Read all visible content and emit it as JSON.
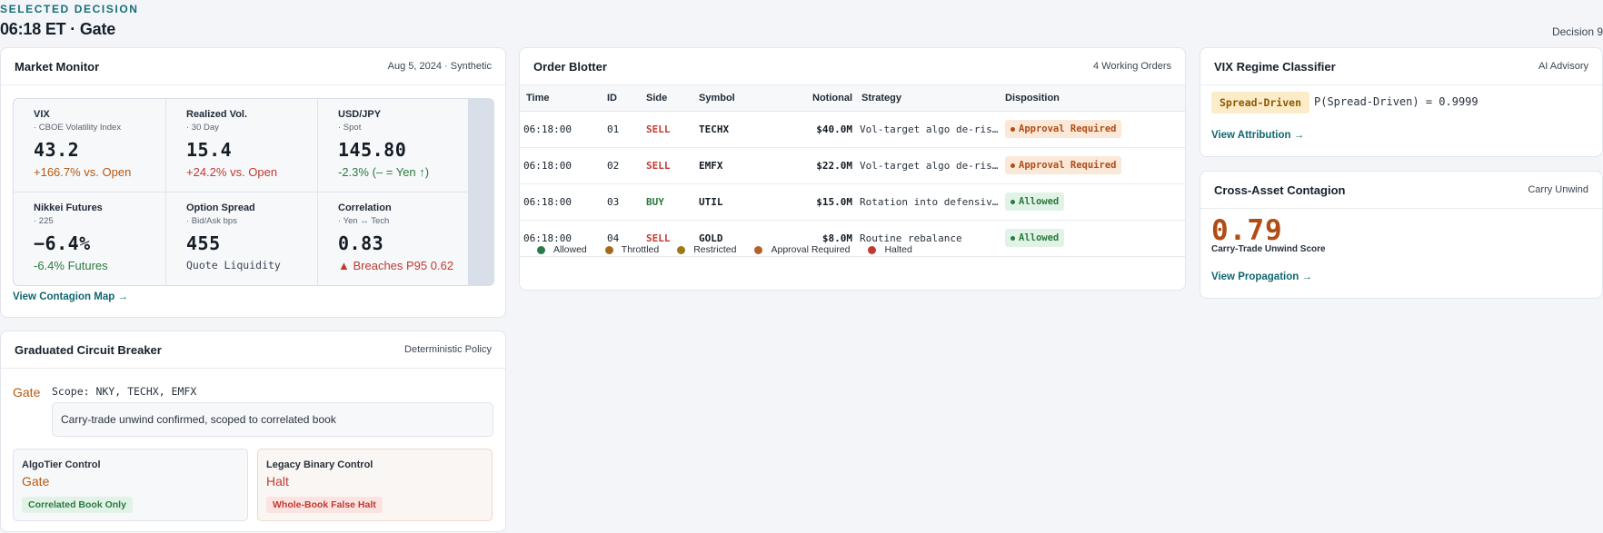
{
  "header": {
    "eyebrow": "SELECTED DECISION",
    "title": "06:18 ET · Gate",
    "decision_label": "Decision 9"
  },
  "market_monitor": {
    "title": "Market Monitor",
    "meta": "Aug 5, 2024 · Synthetic",
    "tiles": [
      {
        "label": "VIX",
        "sub": "· CBOE Volatility Index",
        "value": "43.2",
        "note": "+166.7% vs. Open",
        "tone": "orange"
      },
      {
        "label": "Realized Vol.",
        "sub": "· 30 Day",
        "value": "15.4",
        "note": "+24.2% vs. Open",
        "tone": "red"
      },
      {
        "label": "USD/JPY",
        "sub": "· Spot",
        "value": "145.80",
        "note": "-2.3% (– = Yen ↑)",
        "tone": "green"
      },
      {
        "label": "Nikkei Futures",
        "sub": "· 225",
        "value": "−6.4%",
        "note": "-6.4% Futures",
        "tone": "green"
      },
      {
        "label": "Option Spread",
        "sub": "· Bid/Ask bps",
        "value": "455",
        "note": "Quote Liquidity",
        "tone": "gray"
      },
      {
        "label": "Correlation",
        "sub": "· Yen ↔ Tech",
        "value": "0.83",
        "note": "▲ Breaches P95 0.62",
        "tone": "red"
      }
    ],
    "link": "View Contagion Map →"
  },
  "circuit_breaker": {
    "title": "Graduated Circuit Breaker",
    "meta": "Deterministic Policy",
    "state": "Gate",
    "scope": "Scope: NKY, TECHX, EMFX",
    "message": "Carry-trade unwind confirmed, scoped to correlated book",
    "algotier": {
      "title": "AlgoTier Control",
      "value": "Gate",
      "pill": "Correlated Book Only"
    },
    "legacy": {
      "title": "Legacy Binary Control",
      "value": "Halt",
      "pill": "Whole-Book False Halt"
    }
  },
  "order_blotter": {
    "title": "Order Blotter",
    "meta": "4 Working Orders",
    "columns": [
      "Time",
      "ID",
      "Side",
      "Symbol",
      "Notional",
      "Strategy",
      "Disposition"
    ],
    "rows": [
      {
        "time": "06:18:00",
        "id": "01",
        "side": "SELL",
        "symbol": "TECHX",
        "notional": "$40.0M",
        "strategy": "Vol-target algo de-risking",
        "disposition": "Approval Required"
      },
      {
        "time": "06:18:00",
        "id": "02",
        "side": "SELL",
        "symbol": "EMFX",
        "notional": "$22.0M",
        "strategy": "Vol-target algo de-risking",
        "disposition": "Approval Required"
      },
      {
        "time": "06:18:00",
        "id": "03",
        "side": "BUY",
        "symbol": "UTIL",
        "notional": "$15.0M",
        "strategy": "Rotation into defensives",
        "disposition": "Allowed"
      },
      {
        "time": "06:18:00",
        "id": "04",
        "side": "SELL",
        "symbol": "GOLD",
        "notional": "$8.0M",
        "strategy": "Routine rebalance",
        "disposition": "Allowed"
      }
    ],
    "legend": [
      {
        "label": "Allowed",
        "color": "#2b7a4b"
      },
      {
        "label": "Throttled",
        "color": "#a8681b"
      },
      {
        "label": "Restricted",
        "color": "#9c7a12"
      },
      {
        "label": "Approval Required",
        "color": "#b45f2d"
      },
      {
        "label": "Halted",
        "color": "#c13a32"
      }
    ]
  },
  "vix_regime": {
    "title": "VIX Regime Classifier",
    "meta": "AI Advisory",
    "regime": "Spread-Driven",
    "probability": "P(Spread-Driven) = 0.9999",
    "link": "View Attribution →"
  },
  "contagion": {
    "title": "Cross-Asset Contagion",
    "meta": "Carry Unwind",
    "score": "0.79",
    "score_label": "Carry-Trade Unwind Score",
    "link": "View Propagation →"
  }
}
